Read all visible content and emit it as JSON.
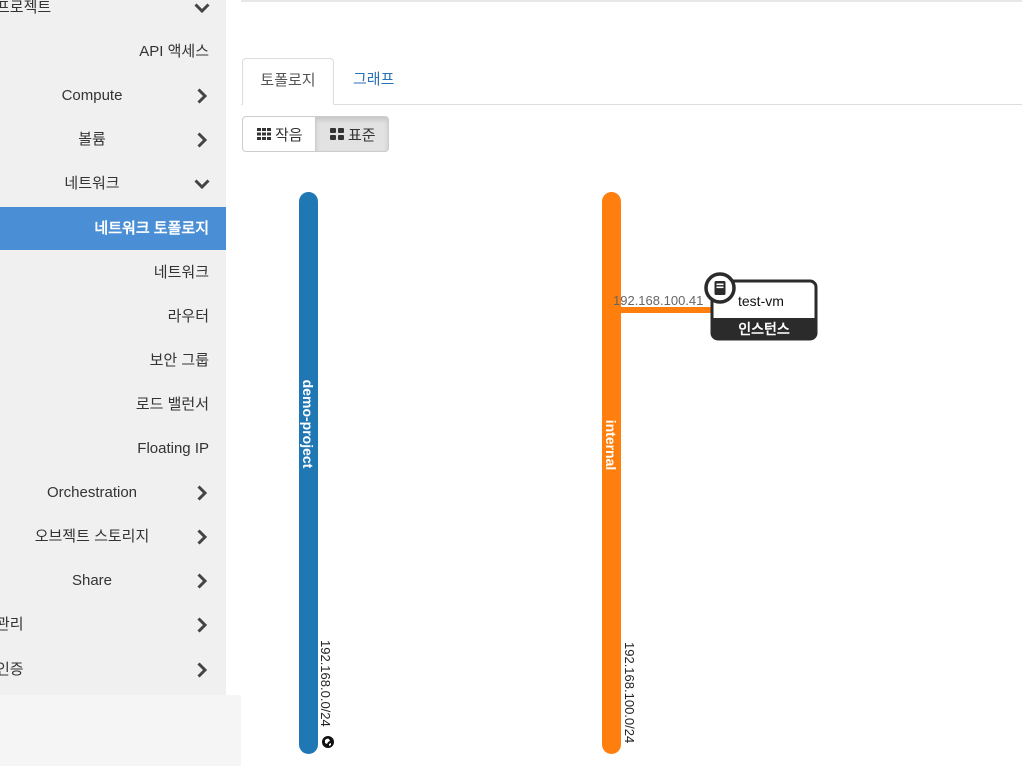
{
  "sidebar": {
    "items": [
      {
        "label": "프로젝트",
        "align": "left",
        "chevron": "down",
        "active": false
      },
      {
        "label": "API 액세스",
        "align": "right",
        "chevron": null,
        "active": false
      },
      {
        "label": "Compute",
        "align": "center",
        "chevron": "right",
        "active": false
      },
      {
        "label": "볼륨",
        "align": "center",
        "chevron": "right",
        "active": false
      },
      {
        "label": "네트워크",
        "align": "center",
        "chevron": "down",
        "active": false
      },
      {
        "label": "네트워크 토폴로지",
        "align": "right",
        "chevron": null,
        "active": true
      },
      {
        "label": "네트워크",
        "align": "right",
        "chevron": null,
        "active": false
      },
      {
        "label": "라우터",
        "align": "right",
        "chevron": null,
        "active": false
      },
      {
        "label": "보안 그룹",
        "align": "right",
        "chevron": null,
        "active": false
      },
      {
        "label": "로드 밸런서",
        "align": "right",
        "chevron": null,
        "active": false
      },
      {
        "label": "Floating IP",
        "align": "right",
        "chevron": null,
        "active": false
      },
      {
        "label": "Orchestration",
        "align": "center",
        "chevron": "right",
        "active": false
      },
      {
        "label": "오브젝트 스토리지",
        "align": "center",
        "chevron": "right",
        "active": false
      },
      {
        "label": "Share",
        "align": "center",
        "chevron": "right",
        "active": false
      },
      {
        "label": "관리",
        "align": "left",
        "chevron": "right",
        "active": false
      },
      {
        "label": "인증",
        "align": "left",
        "chevron": "right",
        "active": false
      }
    ]
  },
  "tabs": {
    "topology": "토폴로지",
    "graph": "그래프"
  },
  "view_toggle": {
    "small": "작음",
    "normal": "표준"
  },
  "topology": {
    "networks": [
      {
        "name": "demo-project",
        "cidr": "192.168.0.0/24",
        "color": "#1f77b4",
        "external": true
      },
      {
        "name": "internal",
        "cidr": "192.168.100.0/24",
        "color": "#ff7f0e",
        "external": false
      }
    ],
    "instance": {
      "name": "test-vm",
      "type": "인스턴스",
      "ip": "192.168.100.41"
    }
  },
  "colors": {
    "accent": "#4a8ed6",
    "link": "#2a72b8"
  }
}
